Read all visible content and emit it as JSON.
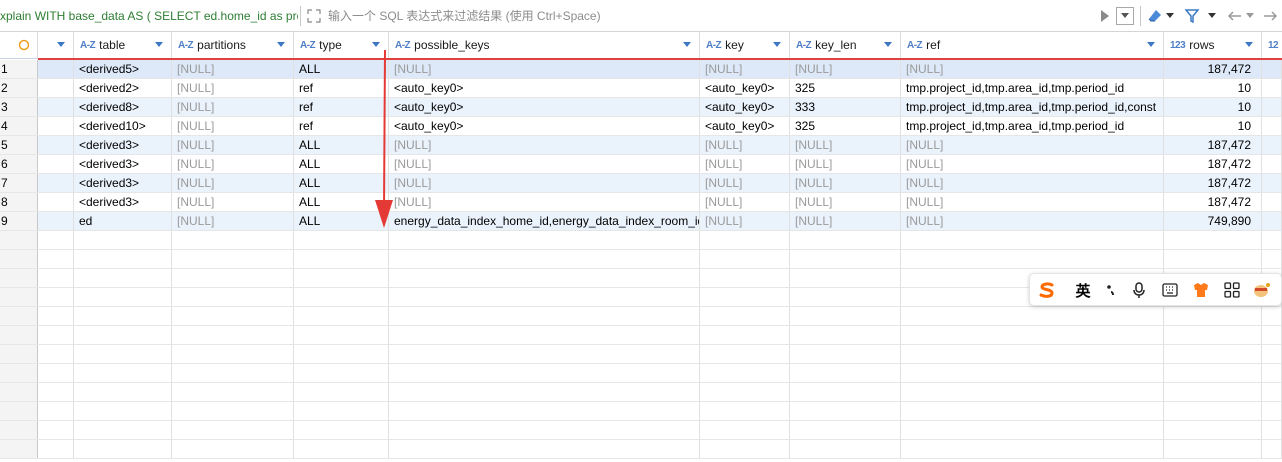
{
  "sql_preview": "xplain WITH base_data AS ( SELECT ed.home_id as projec",
  "filter": {
    "placeholder": "输入一个 SQL 表达式来过滤结果 (使用 Ctrl+Space)",
    "value": ""
  },
  "columns": [
    {
      "type_icon": "",
      "name": ""
    },
    {
      "type_icon": "A-Z",
      "name": "table"
    },
    {
      "type_icon": "A-Z",
      "name": "partitions"
    },
    {
      "type_icon": "A-Z",
      "name": "type"
    },
    {
      "type_icon": "A-Z",
      "name": "possible_keys"
    },
    {
      "type_icon": "A-Z",
      "name": "key"
    },
    {
      "type_icon": "A-Z",
      "name": "key_len"
    },
    {
      "type_icon": "A-Z",
      "name": "ref"
    },
    {
      "type_icon": "123",
      "name": "rows"
    },
    {
      "type_icon": "12",
      "name": ""
    }
  ],
  "rows": [
    {
      "n": "1",
      "id": "",
      "table": "<derived5>",
      "partitions": "[NULL]",
      "type": "ALL",
      "possible_keys": "[NULL]",
      "key": "[NULL]",
      "key_len": "[NULL]",
      "ref": "[NULL]",
      "rows": "187,472"
    },
    {
      "n": "2",
      "id": "",
      "table": "<derived2>",
      "partitions": "[NULL]",
      "type": "ref",
      "possible_keys": "<auto_key0>",
      "key": "<auto_key0>",
      "key_len": "325",
      "ref": "tmp.project_id,tmp.area_id,tmp.period_id",
      "rows": "10"
    },
    {
      "n": "3",
      "id": "",
      "table": "<derived8>",
      "partitions": "[NULL]",
      "type": "ref",
      "possible_keys": "<auto_key0>",
      "key": "<auto_key0>",
      "key_len": "333",
      "ref": "tmp.project_id,tmp.area_id,tmp.period_id,const",
      "rows": "10"
    },
    {
      "n": "4",
      "id": "",
      "table": "<derived10>",
      "partitions": "[NULL]",
      "type": "ref",
      "possible_keys": "<auto_key0>",
      "key": "<auto_key0>",
      "key_len": "325",
      "ref": "tmp.project_id,tmp.area_id,tmp.period_id",
      "rows": "10"
    },
    {
      "n": "5",
      "id": "",
      "table": "<derived3>",
      "partitions": "[NULL]",
      "type": "ALL",
      "possible_keys": "[NULL]",
      "key": "[NULL]",
      "key_len": "[NULL]",
      "ref": "[NULL]",
      "rows": "187,472"
    },
    {
      "n": "6",
      "id": "",
      "table": "<derived3>",
      "partitions": "[NULL]",
      "type": "ALL",
      "possible_keys": "[NULL]",
      "key": "[NULL]",
      "key_len": "[NULL]",
      "ref": "[NULL]",
      "rows": "187,472"
    },
    {
      "n": "7",
      "id": "",
      "table": "<derived3>",
      "partitions": "[NULL]",
      "type": "ALL",
      "possible_keys": "[NULL]",
      "key": "[NULL]",
      "key_len": "[NULL]",
      "ref": "[NULL]",
      "rows": "187,472"
    },
    {
      "n": "8",
      "id": "",
      "table": "<derived3>",
      "partitions": "[NULL]",
      "type": "ALL",
      "possible_keys": "[NULL]",
      "key": "[NULL]",
      "key_len": "[NULL]",
      "ref": "[NULL]",
      "rows": "187,472"
    },
    {
      "n": "9",
      "id": "",
      "table": "ed",
      "partitions": "[NULL]",
      "type": "ALL",
      "possible_keys": "energy_data_index_home_id,energy_data_index_room_id",
      "key": "[NULL]",
      "key_len": "[NULL]",
      "ref": "[NULL]",
      "rows": "749,890"
    }
  ],
  "ime_toolbar": {
    "lang_label": "英",
    "buttons": [
      "sogou-logo-icon",
      "punctuation-icon",
      "microphone-icon",
      "keyboard-icon",
      "skin-icon",
      "apps-grid-icon",
      "avatar-icon"
    ]
  },
  "colors": {
    "accent_blue": "#3c78c4",
    "sql_green": "#2e7d32",
    "annotation_red": "#e53935",
    "row_highlight": "#eaf2fc"
  }
}
